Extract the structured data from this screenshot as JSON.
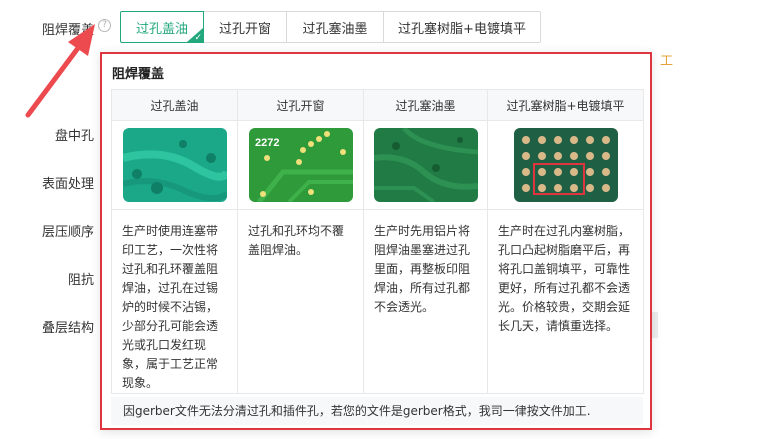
{
  "field": {
    "label": "阻焊覆盖",
    "help_icon": "question-circle-icon",
    "options": [
      {
        "label": "过孔盖油",
        "selected": true
      },
      {
        "label": "过孔开窗",
        "selected": false
      },
      {
        "label": "过孔塞油墨",
        "selected": false
      },
      {
        "label": "过孔塞树脂+电镀填平",
        "selected": false
      }
    ]
  },
  "background_labels": {
    "pad_via": "盘中孔",
    "surface": "表面处理",
    "stack_order": "层压顺序",
    "impedance": "阻抗",
    "stackup": "叠层结构",
    "right_fragment": "工"
  },
  "popover": {
    "title": "阻焊覆盖",
    "columns": [
      "过孔盖油",
      "过孔开窗",
      "过孔塞油墨",
      "过孔塞树脂+电镀填平"
    ],
    "descriptions": [
      "生产时使用连塞带印工艺，一次性将过孔和孔环覆盖阻焊油，过孔在过锡炉的时候不沾锡，少部分孔可能会透光或孔口发红现象，属于工艺正常现象。",
      "过孔和孔环均不覆盖阻焊油。",
      "生产时先用铝片将阻焊油墨塞进过孔里面，再整板印阻焊油，所有过孔都不会透光。",
      "生产时在过孔内塞树脂，孔口凸起树脂磨平后，再将孔口盖铜填平，可靠性更好，所有过孔都不会透光。价格较贵，交期会延长几天，请慎重选择。"
    ],
    "board_text": "2272",
    "footer": "因gerber文件无法分清过孔和插件孔，若您的文件是gerber格式，我司一律按文件加工."
  },
  "colors": {
    "accent": "#23a77d",
    "highlight_border": "#e0353f",
    "arrow": "#ec4a4f"
  }
}
